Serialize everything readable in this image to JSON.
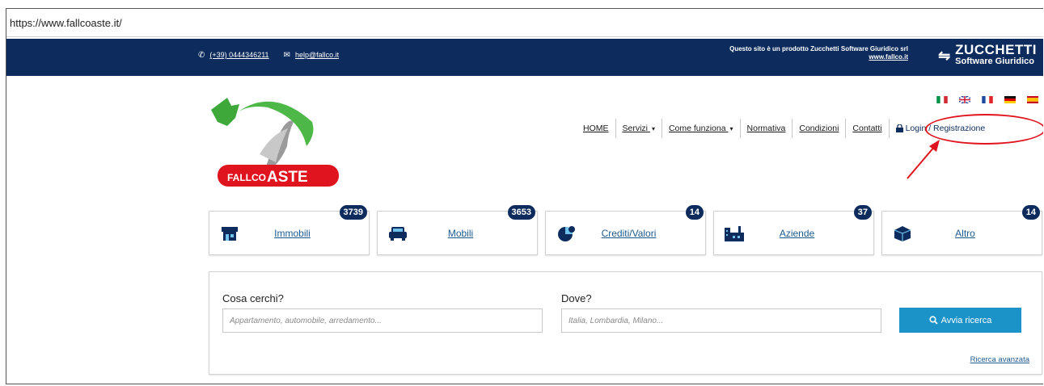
{
  "browser": {
    "url": "https://www.fallcoaste.it/"
  },
  "topbar": {
    "phone": "(+39) 0444346211",
    "email": "help@fallco.it",
    "product_text": "Questo sito è un prodotto Zucchetti Software Giuridico srl",
    "product_link": "www.fallco.it",
    "brand_name": "ZUCCHETTI",
    "brand_sub": "Software Giuridico"
  },
  "logo": {
    "text_small": "FALLCO",
    "text_big": "ASTE"
  },
  "languages": [
    "it",
    "en",
    "fr",
    "de",
    "es"
  ],
  "nav": {
    "items": [
      {
        "label": "HOME"
      },
      {
        "label": "Servizi",
        "caret": "▾"
      },
      {
        "label": "Come funziona",
        "caret": "▾"
      },
      {
        "label": "Normativa"
      },
      {
        "label": "Condizioni"
      },
      {
        "label": "Contatti"
      }
    ],
    "login": "Login / Registrazione"
  },
  "categories": [
    {
      "label": "Immobili",
      "count": "3739",
      "icon": "house-icon"
    },
    {
      "label": "Mobili",
      "count": "3653",
      "icon": "car-icon"
    },
    {
      "label": "Crediti/Valori",
      "count": "14",
      "icon": "coins-icon"
    },
    {
      "label": "Aziende",
      "count": "37",
      "icon": "factory-icon"
    },
    {
      "label": "Altro",
      "count": "14",
      "icon": "box-icon"
    }
  ],
  "search": {
    "what_label": "Cosa cerchi?",
    "what_placeholder": "Appartamento, automobile, arredamento...",
    "where_label": "Dove?",
    "where_placeholder": "Italia, Lombardia, Milano...",
    "button": "Avvia ricerca",
    "advanced": "Ricerca avanzata"
  },
  "colors": {
    "navy": "#0d2b5c",
    "accent": "#1b92c8",
    "annotation": "#e0141e"
  }
}
